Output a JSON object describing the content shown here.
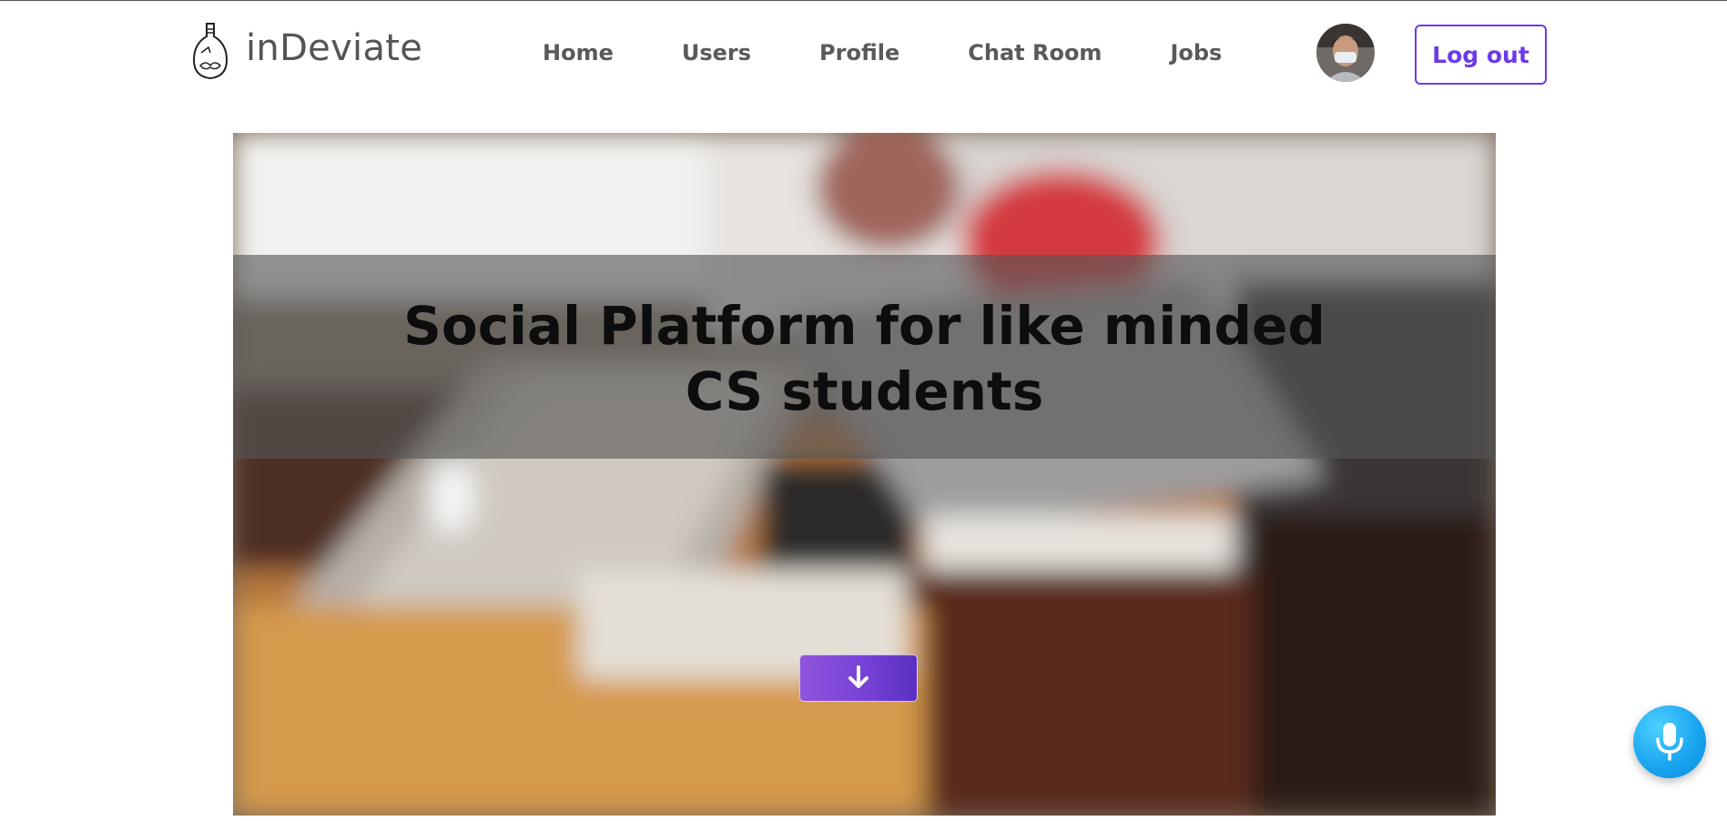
{
  "brand": {
    "name": "inDeviate"
  },
  "nav": {
    "items": [
      {
        "label": "Home"
      },
      {
        "label": "Users"
      },
      {
        "label": "Profile"
      },
      {
        "label": "Chat Room"
      },
      {
        "label": "Jobs"
      }
    ]
  },
  "header": {
    "logout_label": "Log out",
    "avatar_icon": "user-avatar"
  },
  "hero": {
    "title": "Social Platform for like minded CS students",
    "scroll_icon": "arrow-down-icon"
  },
  "fab": {
    "icon": "microphone-icon"
  },
  "colors": {
    "accent": "#6b3be8",
    "nav_text": "#5a5a5a",
    "brand_text": "#555555",
    "mic": "#1aa6f0"
  }
}
